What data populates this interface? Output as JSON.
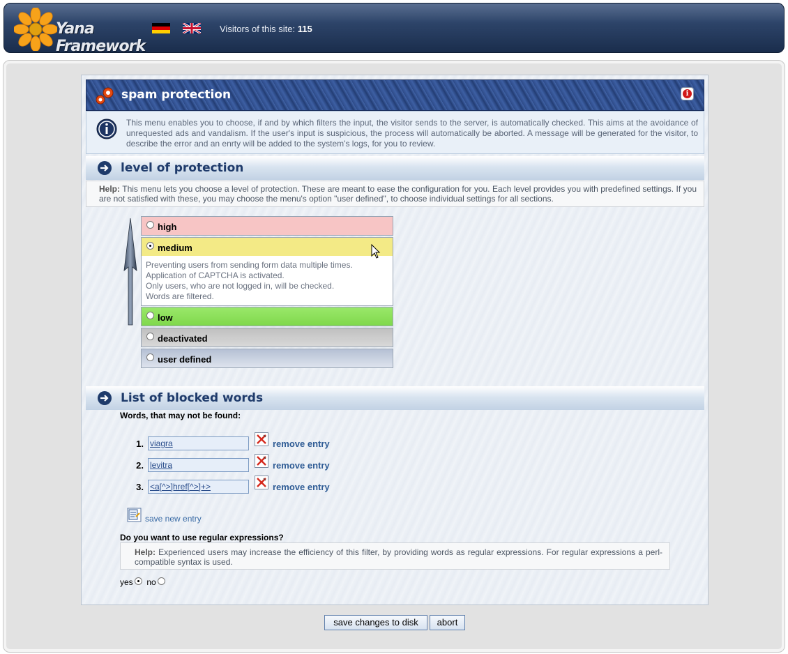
{
  "header": {
    "logo_text": "Yana Framework",
    "flags": [
      "german-flag-icon",
      "english-flag-icon"
    ],
    "visitors_label": "Visitors of this site:",
    "visitors_count": "115"
  },
  "panel": {
    "title": "spam protection",
    "intro": "This menu enables you to choose, if and by which filters the input, the visitor sends to the server, is automatically checked. This aims at the avoidance of unrequested ads and vandalism. If the user's input is suspicious, the process will automatically be aborted. A message will be generated for the visitor, to describe the error and an enrty will be added to the system's logs, for you to review."
  },
  "protection": {
    "title": "level of protection",
    "help_label": "Help:",
    "help_text": "This menu lets you choose a level of protection. These are meant to ease the configuration for you. Each level provides you with predefined settings. If you are not satisfied with these, you may choose the menu's option \"user defined\", to choose individual settings for all sections.",
    "levels": [
      {
        "label": "high",
        "color": "#f7c5c5",
        "selected": false
      },
      {
        "label": "medium",
        "color": "#f3ea86",
        "selected": true
      },
      {
        "label": "low",
        "color": "#8ee25c",
        "selected": false
      },
      {
        "label": "deactivated",
        "color": "#c3c3c3",
        "selected": false
      },
      {
        "label": "user defined",
        "color": "#bcc6d8",
        "selected": false
      }
    ],
    "medium_desc": [
      "Preventing users from sending form data multiple times.",
      "Application of CAPTCHA is activated.",
      "Only users, who are not logged in, will be checked.",
      "Words are filtered."
    ]
  },
  "blocked": {
    "title": "List of blocked words",
    "label": "Words, that may not be found:",
    "entries": [
      {
        "num": "1.",
        "value": "viagra"
      },
      {
        "num": "2.",
        "value": "levitra"
      },
      {
        "num": "3.",
        "value": "<a[^>]href[^>]+>"
      }
    ],
    "remove_label": "remove entry",
    "save_new_label": "save new entry",
    "regex_question": "Do you want to use regular expressions?",
    "regex_help_label": "Help:",
    "regex_help": "Experienced users may increase the efficiency of this filter, by providing words as regular expressions. For regular expressions a perl-compatible syntax is used.",
    "yes_label": "yes",
    "no_label": "no",
    "regex_selected": "yes"
  },
  "buttons": {
    "save": "save changes to disk",
    "abort": "abort"
  }
}
